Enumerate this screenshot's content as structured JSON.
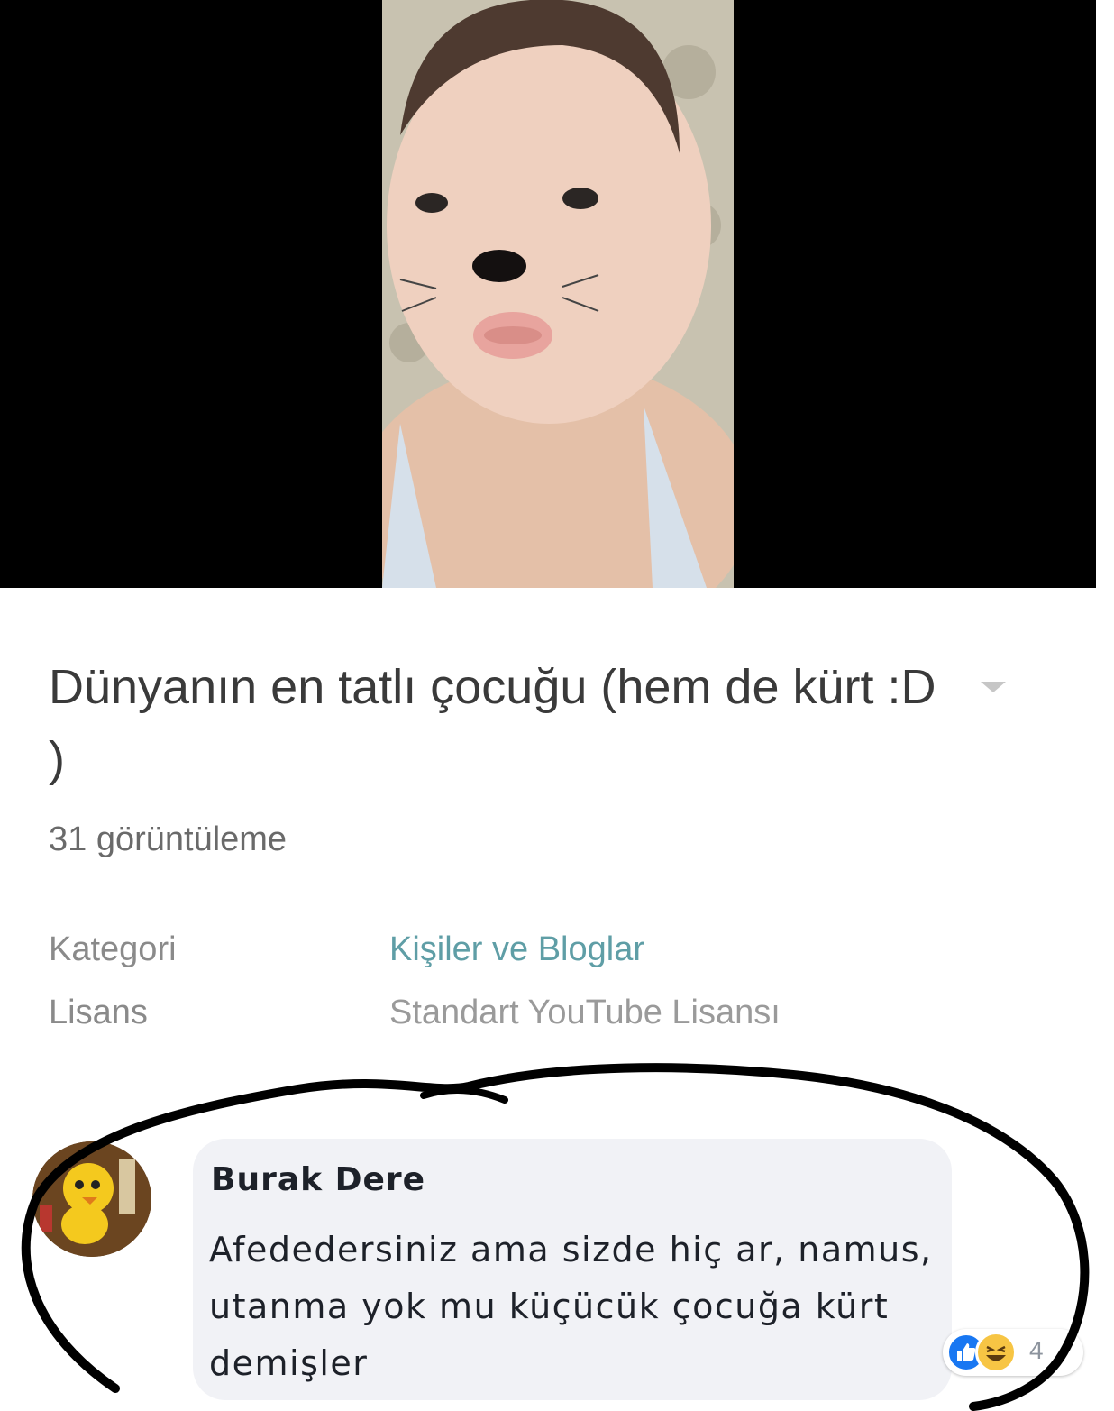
{
  "video": {
    "title": "Dünyanın en tatlı çocuğu (hem de kürt :D )",
    "views": "31 görüntüleme"
  },
  "details": {
    "category_label": "Kategori",
    "category_value": "Kişiler ve Bloglar",
    "license_label": "Lisans",
    "license_value": "Standart YouTube Lisansı"
  },
  "comment": {
    "author": "Burak Dere",
    "text": "Afededersiniz ama sizde hiç ar, namus, utanma yok mu küçücük çocuğa kürt demişler",
    "reaction_count": "4"
  },
  "icons": [
    "chevron-down-icon",
    "like-icon",
    "haha-icon"
  ],
  "colors": {
    "link": "#5f9ea6",
    "like": "#1877f2",
    "haha": "#f7c544",
    "annotation": "#000000"
  }
}
